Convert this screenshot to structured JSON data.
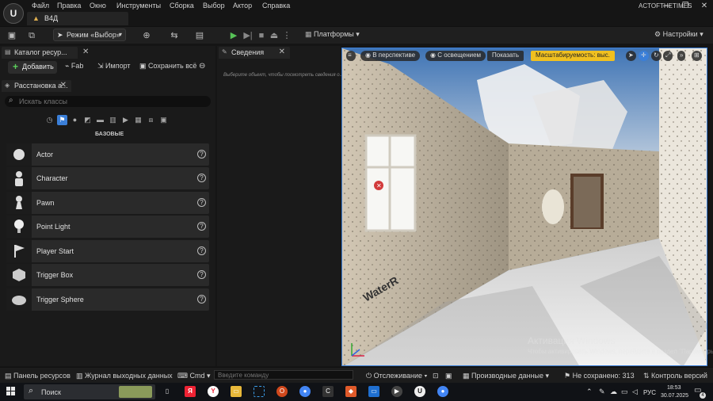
{
  "app": {
    "menu": [
      "Файл",
      "Правка",
      "Окно",
      "Инструменты",
      "Сборка",
      "Выбор",
      "Актор",
      "Справка"
    ],
    "project_name": "ACTOFTHETIMES",
    "level_tab": "В4Д",
    "logo_letter": "U"
  },
  "toolbar": {
    "mode_label": "Режим «Выбор»",
    "platforms_label": "Платформы",
    "settings_label": "Настройки"
  },
  "content_browser": {
    "tab_label": "Каталог ресур...",
    "add_label": "Добавить",
    "fab_label": "Fab",
    "import_label": "Импорт",
    "save_all_label": "Сохранить всё"
  },
  "place_actors": {
    "tab_label": "Расстановка а...",
    "search_placeholder": "Искать классы",
    "category_label": "БАЗОВЫЕ",
    "items": [
      {
        "label": "Actor"
      },
      {
        "label": "Character"
      },
      {
        "label": "Pawn"
      },
      {
        "label": "Point Light"
      },
      {
        "label": "Player Start"
      },
      {
        "label": "Trigger Box"
      },
      {
        "label": "Trigger Sphere"
      }
    ]
  },
  "details": {
    "tab_label": "Сведения",
    "hint": "Выберите объект, чтобы посмотреть сведения о..."
  },
  "viewport": {
    "perspective": "В перспективе",
    "lighting": "С освещением",
    "show": "Показать",
    "scalability": "Масштабируемость: выс.",
    "floor_text": "WaterR"
  },
  "watermark": {
    "title": "Активация Windows",
    "sub": "Чтобы активировать Windows, перейдите в раздел \"Параметры\"."
  },
  "statusbar": {
    "content_drawer": "Панель ресурсов",
    "output_log": "Журнал выходных данных",
    "cmd": "Cmd",
    "cmd_placeholder": "Введите команду",
    "trace": "Отслеживание",
    "derived_data": "Производные данные",
    "unsaved": "Не сохранено: 313",
    "revision_control": "Контроль версий"
  },
  "taskbar": {
    "search_label": "Поиск",
    "lang": "РУС",
    "time": "18:53",
    "date": "30.07.2025",
    "notification_count": "4"
  },
  "colors": {
    "accent_blue": "#3b7fd8",
    "play_green": "#57c257",
    "scalability_yellow": "#f0c020"
  }
}
